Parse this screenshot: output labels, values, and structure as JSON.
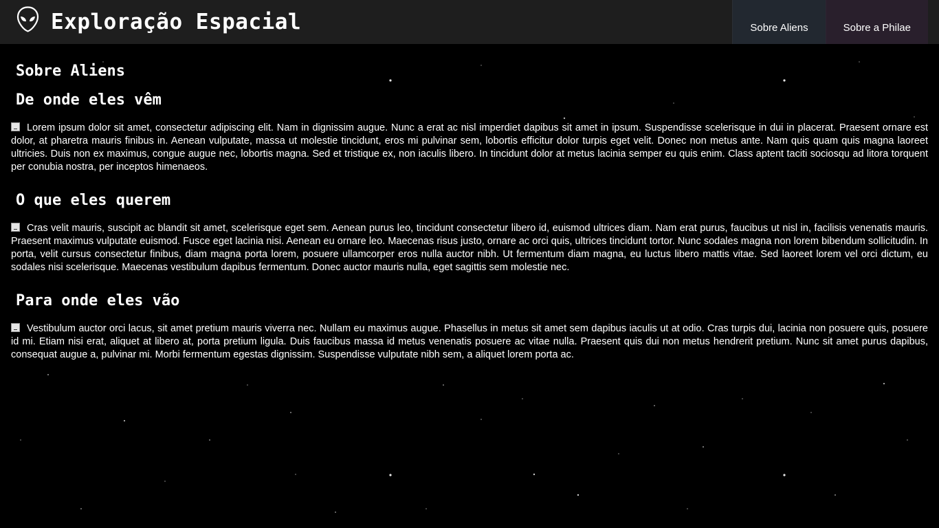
{
  "header": {
    "logo_icon": "alien-head-icon",
    "site_title": "Exploração Espacial",
    "nav": [
      {
        "label": "Sobre Aliens",
        "color": "#222830"
      },
      {
        "label": "Sobre a Philae",
        "color": "#291f2c"
      }
    ]
  },
  "main": {
    "page_title": "Sobre Aliens",
    "sections": [
      {
        "title": "De onde eles vêm",
        "image_icon": "broken-image-icon",
        "text": "Lorem ipsum dolor sit amet, consectetur adipiscing elit. Nam in dignissim augue. Nunc a erat ac nisl imperdiet dapibus sit amet in ipsum. Suspendisse scelerisque in dui in placerat. Praesent ornare est dolor, at pharetra mauris finibus in. Aenean vulputate, massa ut molestie tincidunt, eros mi pulvinar sem, lobortis efficitur dolor turpis eget velit. Donec non metus ante. Nam quis quam quis magna laoreet ultricies. Duis non ex maximus, congue augue nec, lobortis magna. Sed et tristique ex, non iaculis libero. In tincidunt dolor at metus lacinia semper eu quis enim. Class aptent taciti sociosqu ad litora torquent per conubia nostra, per inceptos himenaeos."
      },
      {
        "title": "O que eles querem",
        "image_icon": "broken-image-icon",
        "text": "Cras velit mauris, suscipit ac blandit sit amet, scelerisque eget sem. Aenean purus leo, tincidunt consectetur libero id, euismod ultrices diam. Nam erat purus, faucibus ut nisl in, facilisis venenatis mauris. Praesent maximus vulputate euismod. Fusce eget lacinia nisi. Aenean eu ornare leo. Maecenas risus justo, ornare ac orci quis, ultrices tincidunt tortor. Nunc sodales magna non lorem bibendum sollicitudin. In porta, velit cursus consectetur finibus, diam magna porta lorem, posuere ullamcorper eros nulla auctor nibh. Ut fermentum diam magna, eu luctus libero mattis vitae. Sed laoreet lorem vel orci dictum, eu sodales nisi scelerisque. Maecenas vestibulum dapibus fermentum. Donec auctor mauris nulla, eget sagittis sem molestie nec."
      },
      {
        "title": "Para onde eles vão",
        "image_icon": "broken-image-icon",
        "text": "Vestibulum auctor orci lacus, sit amet pretium mauris viverra nec. Nullam eu maximus augue. Phasellus in metus sit amet sem dapibus iaculis ut at odio. Cras turpis dui, lacinia non posuere quis, posuere id mi. Etiam nisi erat, aliquet at libero at, porta pretium ligula. Duis faucibus massa id metus venenatis posuere ac vitae nulla. Praesent quis dui non metus hendrerit pretium. Nunc sit amet purus dapibus, consequat augue a, pulvinar mi. Morbi fermentum egestas dignissim. Suspendisse vulputate nibh sem, a aliquet lorem porta ac."
      }
    ]
  },
  "background": {
    "color": "#000000",
    "pattern_icon": "starfield-background"
  }
}
